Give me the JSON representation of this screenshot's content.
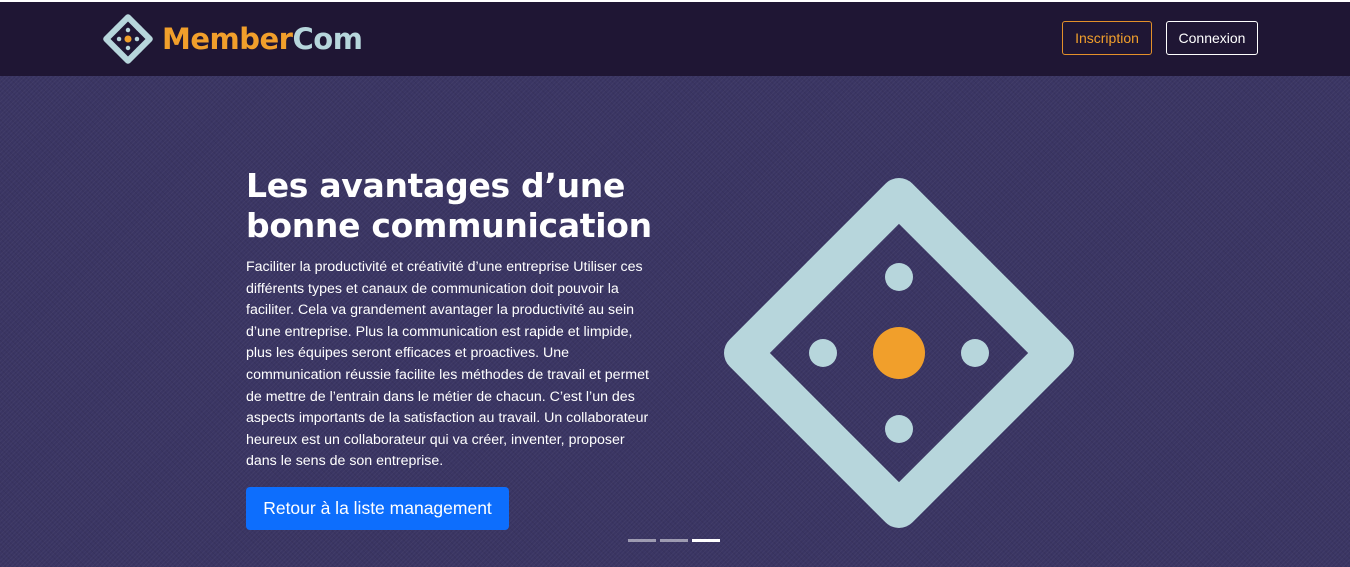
{
  "brand": {
    "part1": "Member",
    "part2": "Com",
    "icon": "membercom-logo-icon"
  },
  "nav": {
    "inscription_label": "Inscription",
    "connexion_label": "Connexion"
  },
  "hero": {
    "title_line1": "Les avantages d’une",
    "title_line2": "bonne communication",
    "paragraph": "Faciliter la productivité et créativité d’une entreprise Utiliser ces différents types et canaux de communication doit pouvoir la faciliter. Cela va grandement avantager la productivité au sein d’une entreprise. Plus la communication est rapide et limpide, plus les équipes seront efficaces et proactives. Une communication réussie facilite les méthodes de travail et permet de mettre de l’entrain dans le métier de chacun. C’est l’un des aspects importants de la satisfaction au travail. Un collaborateur heureux est un collaborateur qui va créer, inventer, proposer dans le sens de son entreprise.",
    "button_label": "Retour à la liste management",
    "illustration_icon": "membercom-large-logo-icon"
  },
  "carousel": {
    "slide_count": 3,
    "active_index": 2
  },
  "colors": {
    "navbar_bg": "#1f1634",
    "hero_bg": "#3a3563",
    "accent_orange": "#f19f2b",
    "logo_light_blue": "#b7d6dc",
    "primary_button": "#0d6efd"
  }
}
